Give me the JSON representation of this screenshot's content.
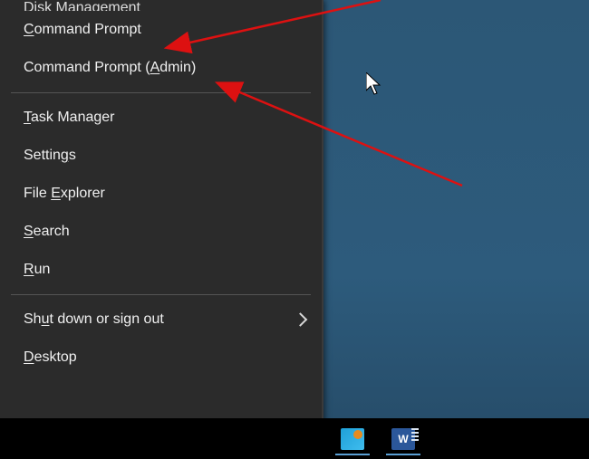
{
  "menu": {
    "items": [
      {
        "label_pre": "",
        "accel": "",
        "label_post": "Disk Management",
        "cut": true
      },
      {
        "label_pre": "",
        "accel": "C",
        "label_post": "ommand Prompt"
      },
      {
        "label_pre": "Command Prompt (",
        "accel": "A",
        "label_post": "dmin)"
      },
      {
        "sep": true
      },
      {
        "label_pre": "",
        "accel": "T",
        "label_post": "ask Manager"
      },
      {
        "label_pre": "Settin",
        "accel": "g",
        "label_post": "s"
      },
      {
        "label_pre": "File ",
        "accel": "E",
        "label_post": "xplorer"
      },
      {
        "label_pre": "",
        "accel": "S",
        "label_post": "earch"
      },
      {
        "label_pre": "",
        "accel": "R",
        "label_post": "un"
      },
      {
        "sep": true
      },
      {
        "label_pre": "Sh",
        "accel": "u",
        "label_post": "t down or sign out",
        "submenu": true
      },
      {
        "label_pre": "",
        "accel": "D",
        "label_post": "esktop"
      }
    ]
  },
  "taskbar": {
    "icons": [
      "system-monitor-icon",
      "word-icon"
    ]
  }
}
